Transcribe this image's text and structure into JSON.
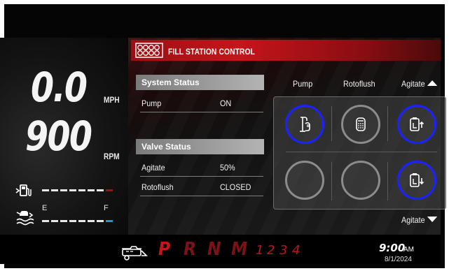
{
  "speed": {
    "value": "0.0",
    "unit": "MPH"
  },
  "rpm": {
    "value": "900",
    "unit": "RPM"
  },
  "fuel_gauge": {
    "icon": "fuel-pump-icon",
    "level": 0.0
  },
  "water_gauge": {
    "icon": "water-tank-icon",
    "empty_label": "E",
    "full_label": "F",
    "level": 1.0
  },
  "header": {
    "title": "FILL STATION CONTROL",
    "icon": "fill-station-icon"
  },
  "system_status": {
    "title": "System Status",
    "rows": [
      {
        "label": "Pump",
        "value": "ON"
      }
    ]
  },
  "valve_status": {
    "title": "Valve Status",
    "rows": [
      {
        "label": "Agitate",
        "value": "50%"
      },
      {
        "label": "Rotoflush",
        "value": "CLOSED"
      }
    ]
  },
  "controls": {
    "columns": [
      "Pump",
      "Rotoflush",
      "Agitate"
    ],
    "agitate_bottom": "Agitate",
    "buttons": [
      {
        "name": "pump-button",
        "icon": "pump-hand-icon",
        "state": "active"
      },
      {
        "name": "rotoflush-button",
        "icon": "rotoflush-nozzle-icon",
        "state": "idle"
      },
      {
        "name": "agitate-up-button",
        "icon": "agitate-up-icon",
        "state": "active"
      },
      {
        "name": "empty-button-1",
        "icon": "",
        "state": "idle"
      },
      {
        "name": "empty-button-2",
        "icon": "",
        "state": "idle"
      },
      {
        "name": "agitate-down-button",
        "icon": "agitate-down-icon",
        "state": "active"
      }
    ]
  },
  "gear_selector": {
    "icon": "fill-truck-icon",
    "gears": [
      "P",
      "R",
      "N",
      "M"
    ],
    "manual_gears": [
      "1",
      "2",
      "3",
      "4"
    ],
    "active_gear": "P"
  },
  "clock": {
    "time": "9:00",
    "ampm": "AM",
    "date": "8/1/2024"
  },
  "colors": {
    "accent_red": "#c5151b",
    "active_blue": "#1a22ff",
    "fuel_end": "#8a1a1a",
    "water_end": "#1a9bd6"
  }
}
